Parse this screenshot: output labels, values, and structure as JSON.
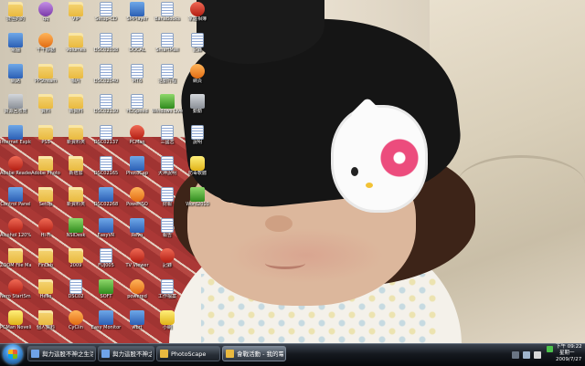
{
  "desktop_icons": [
    {
      "label": "捷徑的的",
      "kind": "folder",
      "col": 0,
      "row": 0
    },
    {
      "label": "電腦",
      "kind": "app",
      "col": 0,
      "row": 1
    },
    {
      "label": "網路",
      "kind": "app",
      "col": 0,
      "row": 2
    },
    {
      "label": "資源回收筒",
      "kind": "gray",
      "col": 0,
      "row": 3
    },
    {
      "label": "Internet Explorer",
      "kind": "app",
      "col": 0,
      "row": 4
    },
    {
      "label": "Adobe Reader",
      "kind": "red",
      "col": 0,
      "row": 5
    },
    {
      "label": "Control Panel",
      "kind": "app",
      "col": 0,
      "row": 6
    },
    {
      "label": "Alcohol 120%",
      "kind": "red",
      "col": 0,
      "row": 7
    },
    {
      "label": "ZOOM File Manager",
      "kind": "folder",
      "col": 0,
      "row": 8
    },
    {
      "label": "Nero StartSmart",
      "kind": "red",
      "col": 0,
      "row": 9
    },
    {
      "label": "PCMan Novelist",
      "kind": "yellow",
      "col": 0,
      "row": 10
    },
    {
      "label": "qq",
      "kind": "purple",
      "col": 1,
      "row": 0
    },
    {
      "label": "千千靜聽",
      "kind": "orange",
      "col": 1,
      "row": 1
    },
    {
      "label": "PPStream",
      "kind": "folder",
      "col": 1,
      "row": 2
    },
    {
      "label": "資料",
      "kind": "folder",
      "col": 1,
      "row": 3
    },
    {
      "label": "PSS",
      "kind": "folder",
      "col": 1,
      "row": 4
    },
    {
      "label": "Adobe Photo",
      "kind": "folder",
      "col": 1,
      "row": 5
    },
    {
      "label": "Setup",
      "kind": "folder",
      "col": 1,
      "row": 6
    },
    {
      "label": "Hi-Fi",
      "kind": "red",
      "col": 1,
      "row": 7
    },
    {
      "label": "FinLab",
      "kind": "folder",
      "col": 1,
      "row": 8
    },
    {
      "label": "Hello",
      "kind": "folder",
      "col": 1,
      "row": 9
    },
    {
      "label": "個人資料",
      "kind": "folder",
      "col": 1,
      "row": 10
    },
    {
      "label": "VIP",
      "kind": "folder",
      "col": 2,
      "row": 0
    },
    {
      "label": "volumes",
      "kind": "folder",
      "col": 2,
      "row": 1
    },
    {
      "label": "相片",
      "kind": "folder",
      "col": 2,
      "row": 2
    },
    {
      "label": "新資料",
      "kind": "folder",
      "col": 2,
      "row": 3
    },
    {
      "label": "新資料夾",
      "kind": "folder",
      "col": 2,
      "row": 4
    },
    {
      "label": "新增加",
      "kind": "folder",
      "col": 2,
      "row": 5
    },
    {
      "label": "新資料夾",
      "kind": "folder",
      "col": 2,
      "row": 6
    },
    {
      "label": "NSIDesk",
      "kind": "green",
      "col": 2,
      "row": 7
    },
    {
      "label": "2009",
      "kind": "folder",
      "col": 2,
      "row": 8
    },
    {
      "label": "DSC02",
      "kind": "doc",
      "col": 2,
      "row": 9
    },
    {
      "label": "CyClin",
      "kind": "orange",
      "col": 2,
      "row": 10
    },
    {
      "label": "Setup-CD",
      "kind": "doc",
      "col": 3,
      "row": 0
    },
    {
      "label": "DSC02038",
      "kind": "doc",
      "col": 3,
      "row": 1
    },
    {
      "label": "DSC02040",
      "kind": "doc",
      "col": 3,
      "row": 2
    },
    {
      "label": "DSC02130",
      "kind": "doc",
      "col": 3,
      "row": 3
    },
    {
      "label": "DSC02137",
      "kind": "doc",
      "col": 3,
      "row": 4
    },
    {
      "label": "DSC02165",
      "kind": "doc",
      "col": 3,
      "row": 5
    },
    {
      "label": "DSC02268",
      "kind": "app",
      "col": 3,
      "row": 6
    },
    {
      "label": "EasyVR",
      "kind": "app",
      "col": 3,
      "row": 7
    },
    {
      "label": "FUJ005",
      "kind": "doc",
      "col": 3,
      "row": 8
    },
    {
      "label": "SOFT",
      "kind": "green",
      "col": 3,
      "row": 9
    },
    {
      "label": "Easy Monitor",
      "kind": "app",
      "col": 3,
      "row": 10
    },
    {
      "label": "SMPlayer",
      "kind": "app",
      "col": 4,
      "row": 0
    },
    {
      "label": "DOCAL",
      "kind": "doc",
      "col": 4,
      "row": 1
    },
    {
      "label": "MT6",
      "kind": "doc",
      "col": 4,
      "row": 2
    },
    {
      "label": "HDSpeed",
      "kind": "doc",
      "col": 4,
      "row": 3
    },
    {
      "label": "PCMan",
      "kind": "red",
      "col": 4,
      "row": 4
    },
    {
      "label": "PhotoCap",
      "kind": "app",
      "col": 4,
      "row": 5
    },
    {
      "label": "PowerISO",
      "kind": "orange",
      "col": 4,
      "row": 6
    },
    {
      "label": "Revo",
      "kind": "app",
      "col": 4,
      "row": 7
    },
    {
      "label": "TV Viewer",
      "kind": "red",
      "col": 4,
      "row": 8
    },
    {
      "label": "powered",
      "kind": "orange",
      "col": 4,
      "row": 9
    },
    {
      "label": "wbrt",
      "kind": "app",
      "col": 4,
      "row": 10
    },
    {
      "label": "BanaBooks",
      "kind": "doc",
      "col": 5,
      "row": 0
    },
    {
      "label": "SmartMail",
      "kind": "doc",
      "col": 5,
      "row": 1
    },
    {
      "label": "活動行程",
      "kind": "doc",
      "col": 5,
      "row": 2
    },
    {
      "label": "Windows Live Messenger",
      "kind": "green",
      "col": 5,
      "row": 3
    },
    {
      "label": "三國志",
      "kind": "doc",
      "col": 5,
      "row": 4
    },
    {
      "label": "犬神說明",
      "kind": "doc",
      "col": 5,
      "row": 5
    },
    {
      "label": "財報",
      "kind": "doc",
      "col": 5,
      "row": 6
    },
    {
      "label": "報告",
      "kind": "doc",
      "col": 5,
      "row": 7
    },
    {
      "label": "記錄",
      "kind": "red",
      "col": 5,
      "row": 8
    },
    {
      "label": "工作檔案",
      "kind": "doc",
      "col": 5,
      "row": 9
    },
    {
      "label": "小網",
      "kind": "yellow",
      "col": 5,
      "row": 10
    },
    {
      "label": "家庭相簿",
      "kind": "red",
      "col": 6,
      "row": 0
    },
    {
      "label": "記錄",
      "kind": "doc",
      "col": 6,
      "row": 1
    },
    {
      "label": "網頁",
      "kind": "orange",
      "col": 6,
      "row": 2
    },
    {
      "label": "動動",
      "kind": "gray",
      "col": 6,
      "row": 3
    },
    {
      "label": "說明",
      "kind": "doc",
      "col": 6,
      "row": 4
    },
    {
      "label": "防毒軟體",
      "kind": "yellow",
      "col": 6,
      "row": 5
    },
    {
      "label": "Word2010",
      "kind": "green",
      "col": 6,
      "row": 6
    }
  ],
  "taskbar": {
    "buttons": [
      {
        "label": "與力這股不神之生活",
        "active": false,
        "color": "#6fa3e8"
      },
      {
        "label": "與力這股不神之生活",
        "active": false,
        "color": "#6fa3e8"
      },
      {
        "label": "PhotoScape",
        "active": false,
        "color": "#e9b93f"
      },
      {
        "label": "會戰活動 - 我的電腦",
        "active": true,
        "color": "#e9b93f"
      }
    ]
  },
  "tray": {
    "time": "下午 09:22",
    "weekday": "星期一",
    "date": "2009/7/27"
  },
  "colors": {
    "taskbar": "#15191f",
    "accent": "#3f8edb"
  }
}
